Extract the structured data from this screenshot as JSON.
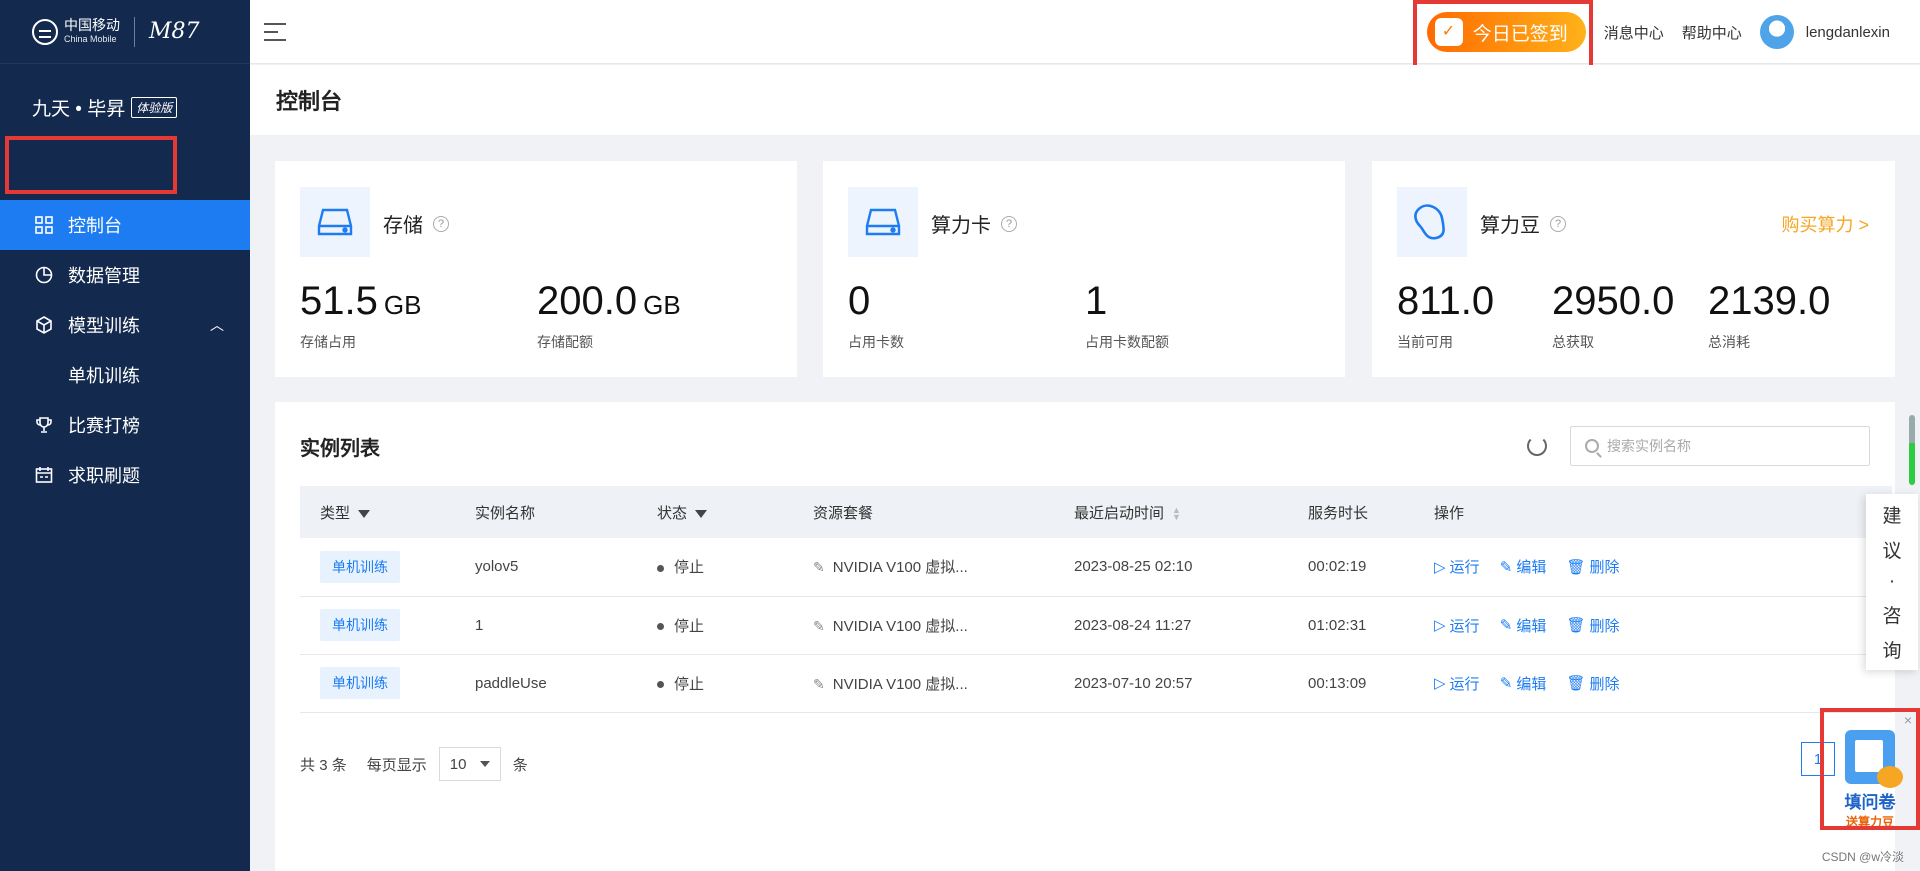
{
  "brand": {
    "name": "中国移动",
    "sub": "China Mobile",
    "signature": "M87"
  },
  "product": {
    "name": "九天 • 毕昇",
    "edition": "体验版"
  },
  "sidebar": {
    "items": [
      {
        "label": "控制台"
      },
      {
        "label": "数据管理"
      },
      {
        "label": "模型训练"
      },
      {
        "label": "单机训练"
      },
      {
        "label": "比赛打榜"
      },
      {
        "label": "求职刷题"
      }
    ]
  },
  "header": {
    "checkin": "今日已签到",
    "message_center": "消息中心",
    "help_center": "帮助中心",
    "username": "lengdanlexin"
  },
  "page": {
    "title": "控制台"
  },
  "cards": {
    "storage": {
      "title": "存储",
      "stats": [
        {
          "value": "51.5",
          "unit": "GB",
          "label": "存储占用"
        },
        {
          "value": "200.0",
          "unit": "GB",
          "label": "存储配额"
        }
      ]
    },
    "gpu": {
      "title": "算力卡",
      "stats": [
        {
          "value": "0",
          "label": "占用卡数"
        },
        {
          "value": "1",
          "label": "占用卡数配额"
        }
      ]
    },
    "beans": {
      "title": "算力豆",
      "buy": "购买算力 >",
      "stats": [
        {
          "value": "811.0",
          "label": "当前可用"
        },
        {
          "value": "2950.0",
          "label": "总获取"
        },
        {
          "value": "2139.0",
          "label": "总消耗"
        }
      ]
    }
  },
  "instances": {
    "title": "实例列表",
    "search_placeholder": "搜索实例名称",
    "columns": [
      "类型",
      "实例名称",
      "状态",
      "资源套餐",
      "最近启动时间",
      "服务时长",
      "操作"
    ],
    "rows": [
      {
        "type": "单机训练",
        "name": "yolov5",
        "status": "停止",
        "package": "NVIDIA V100 虚拟...",
        "started": "2023-08-25 02:10",
        "duration": "00:02:19"
      },
      {
        "type": "单机训练",
        "name": "1",
        "status": "停止",
        "package": "NVIDIA V100 虚拟...",
        "started": "2023-08-24 11:27",
        "duration": "01:02:31"
      },
      {
        "type": "单机训练",
        "name": "paddleUse",
        "status": "停止",
        "package": "NVIDIA V100 虚拟...",
        "started": "2023-07-10 20:57",
        "duration": "00:13:09"
      }
    ],
    "actions": {
      "run": "运行",
      "edit": "编辑",
      "delete": "删除"
    },
    "pager": {
      "total_prefix": "共",
      "total": "3",
      "total_suffix": "条",
      "per_page_label": "每页显示",
      "per_page": "10",
      "per_page_suffix": "条",
      "current_page": "1"
    }
  },
  "float": {
    "advice": [
      "建",
      "议",
      "·",
      "咨",
      "询"
    ],
    "survey_title": "填问卷",
    "survey_sub": "送算力豆"
  },
  "watermark": "CSDN @w冷淡",
  "colors": {
    "sidebar": "#13294d",
    "accent": "#1d7cf2",
    "highlight": "#e53935",
    "orange": "#f5a623"
  }
}
